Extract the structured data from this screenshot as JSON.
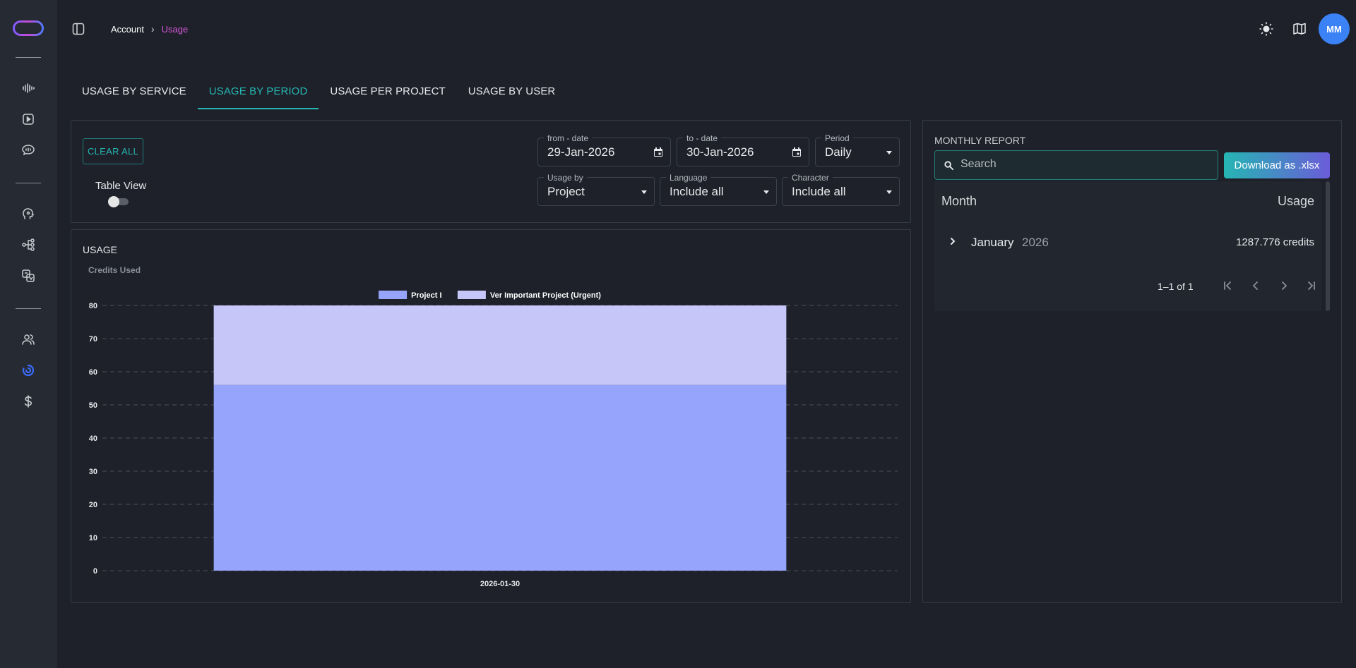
{
  "breadcrumb": {
    "account": "Account",
    "current": "Usage"
  },
  "user": {
    "initials": "MM"
  },
  "tabs": [
    {
      "label": "USAGE BY SERVICE",
      "active": false
    },
    {
      "label": "USAGE BY PERIOD",
      "active": true
    },
    {
      "label": "USAGE PER PROJECT",
      "active": false
    },
    {
      "label": "USAGE BY USER",
      "active": false
    }
  ],
  "filters": {
    "clear_all": "CLEAR ALL",
    "table_view_label": "Table View",
    "table_view_on": false,
    "from_date": {
      "label": "from - date",
      "value": "29-Jan-2026"
    },
    "to_date": {
      "label": "to - date",
      "value": "30-Jan-2026"
    },
    "period": {
      "label": "Period",
      "value": "Daily"
    },
    "usage_by": {
      "label": "Usage by",
      "value": "Project"
    },
    "language": {
      "label": "Language",
      "value": "Include all"
    },
    "character": {
      "label": "Character",
      "value": "Include all"
    }
  },
  "chart": {
    "title": "USAGE",
    "y_title": "Credits Used"
  },
  "chart_data": {
    "type": "bar",
    "stacked": true,
    "categories": [
      "2026-01-30"
    ],
    "series": [
      {
        "name": "Project I",
        "values": [
          56
        ],
        "color": "#96a5fb"
      },
      {
        "name": "Ver Important Project (Urgent)",
        "values": [
          24
        ],
        "color": "#c7c6f8"
      }
    ],
    "ylabel": "Credits Used",
    "ylim": [
      0,
      80
    ],
    "yticks": [
      0,
      10,
      20,
      30,
      40,
      50,
      60,
      70,
      80
    ],
    "grid": true,
    "legend": "top-center"
  },
  "report": {
    "title": "MONTHLY REPORT",
    "search_placeholder": "Search",
    "download_label": "Download as .xlsx",
    "columns": {
      "month": "Month",
      "usage": "Usage"
    },
    "rows": [
      {
        "month": "January",
        "year": "2026",
        "usage": "1287.776 credits"
      }
    ],
    "pagination": "1–1 of 1"
  },
  "colors": {
    "accent": "#25b6b3",
    "breadcrumb_active": "#d457d8",
    "avatar": "#3b82f6"
  }
}
